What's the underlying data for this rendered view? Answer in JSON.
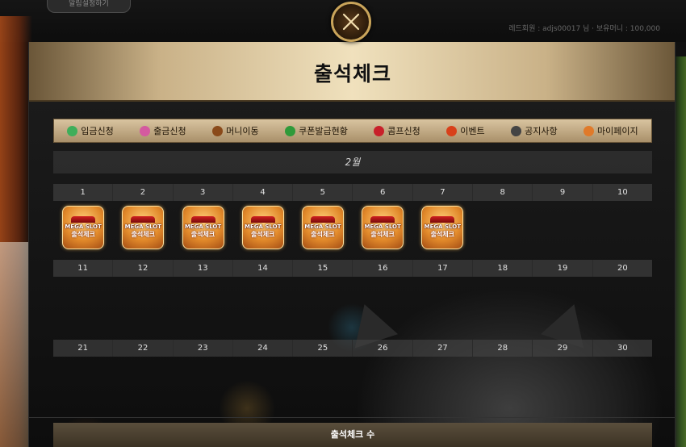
{
  "background": {
    "top_pill_label": "알림설정하기",
    "user_info": "레드회원 : adjs00017 님 · 보유머니 : 100,000"
  },
  "modal": {
    "title": "출석체크",
    "close_icon": "close-x-icon",
    "accent_color": "#c9a45a"
  },
  "nav": {
    "items": [
      {
        "label": "입금신청",
        "icon": "money-bag-icon",
        "icon_color": "#3fae5a"
      },
      {
        "label": "출금신청",
        "icon": "coin-icon",
        "icon_color": "#d45aa0"
      },
      {
        "label": "머니이동",
        "icon": "chest-icon",
        "icon_color": "#8a4a1a"
      },
      {
        "label": "쿠폰발급현황",
        "icon": "gift-icon",
        "icon_color": "#2f9a3a"
      },
      {
        "label": "콤프신청",
        "icon": "cherry-icon",
        "icon_color": "#c8202a"
      },
      {
        "label": "이벤트",
        "icon": "star-icon",
        "icon_color": "#d8401a"
      },
      {
        "label": "공지사항",
        "icon": "megaphone-icon",
        "icon_color": "#444444"
      },
      {
        "label": "마이페이지",
        "icon": "house-icon",
        "icon_color": "#e07a2a"
      }
    ]
  },
  "calendar": {
    "month_label": "2월",
    "rows": [
      {
        "days": [
          "1",
          "2",
          "3",
          "4",
          "5",
          "6",
          "7",
          "8",
          "9",
          "10"
        ],
        "stamped": [
          true,
          true,
          true,
          true,
          true,
          true,
          true,
          false,
          false,
          false
        ]
      },
      {
        "days": [
          "11",
          "12",
          "13",
          "14",
          "15",
          "16",
          "17",
          "18",
          "19",
          "20"
        ],
        "stamped": [
          false,
          false,
          false,
          false,
          false,
          false,
          false,
          false,
          false,
          false
        ]
      },
      {
        "days": [
          "21",
          "22",
          "23",
          "24",
          "25",
          "26",
          "27",
          "28",
          "29",
          "30"
        ],
        "stamped": [
          false,
          false,
          false,
          false,
          false,
          false,
          false,
          false,
          false,
          false
        ]
      }
    ],
    "stamp": {
      "brand": "MEGA SLOT",
      "label": "출석체크"
    }
  },
  "footer": {
    "count_label": "출석체크 수"
  }
}
